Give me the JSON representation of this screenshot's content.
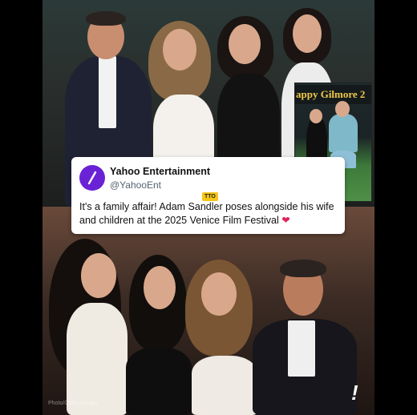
{
  "tweet": {
    "account_name": "Yahoo Entertainment",
    "handle": "@YahooEnt",
    "badge": "TTO",
    "text": "It's a family affair! Adam Sandler poses alongside his wife and children at the 2025 Venice Film Festival",
    "emoji": "❤"
  },
  "inset": {
    "banner_text": "appy Gilmore 2"
  },
  "photo": {
    "credit": "Photo/Getty Images"
  },
  "colors": {
    "avatar": "#6a22d6",
    "heart": "#e0245e",
    "badge": "#f5c518"
  }
}
